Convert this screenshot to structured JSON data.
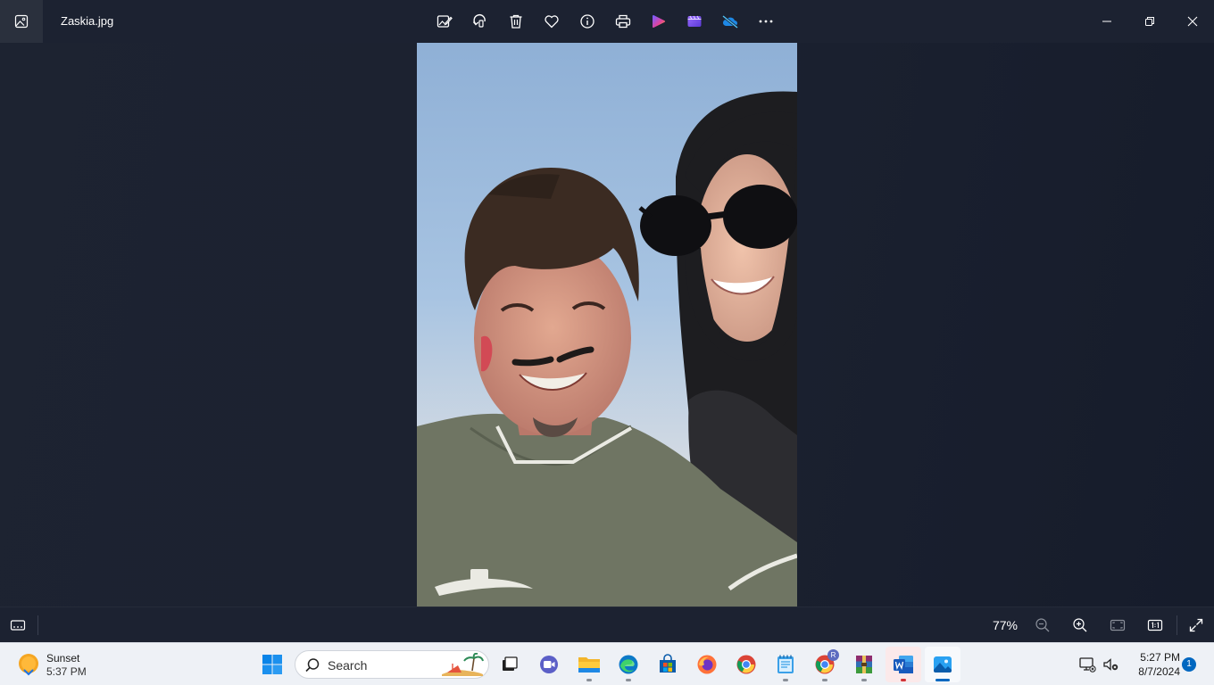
{
  "app": {
    "title": "Zaskia.jpg"
  },
  "toolbar": {
    "items": [
      "edit-image",
      "rotate",
      "delete",
      "favorite",
      "file-info",
      "print",
      "clipchamp",
      "video-editor",
      "onedrive-sync-off",
      "see-more"
    ]
  },
  "statusbar": {
    "zoom": "77%"
  },
  "taskbar": {
    "weather_title": "Sunset",
    "weather_time": "5:37 PM",
    "search_placeholder": "Search",
    "chrome_profile_badge": "R",
    "time": "5:27 PM",
    "date": "8/7/2024",
    "notification_count": "1"
  },
  "colors": {
    "background": "#1b2130",
    "titlebar": "#1c2231",
    "taskbar": "#eef1f6",
    "accent": "#0067c0"
  }
}
